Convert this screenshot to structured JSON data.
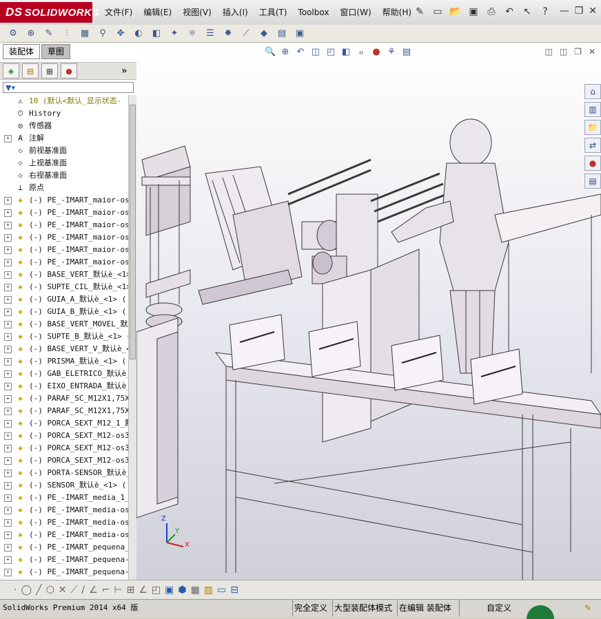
{
  "app": {
    "brand": "SOLIDWORKS",
    "brand_prefix": "DS"
  },
  "menu": [
    "文件(F)",
    "编辑(E)",
    "视图(V)",
    "插入(I)",
    "工具(T)",
    "Toolbox",
    "窗口(W)",
    "帮助(H)"
  ],
  "panel_tabs": [
    "装配体",
    "草图"
  ],
  "filter_icon": "filter-icon",
  "tree": [
    {
      "label": "10  (默认<默认_显示状态-",
      "icon": "assembly",
      "root": true,
      "expand": ""
    },
    {
      "label": "History",
      "icon": "history",
      "expand": ""
    },
    {
      "label": "传感器",
      "icon": "sensor",
      "expand": ""
    },
    {
      "label": "注解",
      "icon": "annotation",
      "expand": "+"
    },
    {
      "label": "前视基准面",
      "icon": "plane",
      "expand": ""
    },
    {
      "label": "上视基准面",
      "icon": "plane",
      "expand": ""
    },
    {
      "label": "右视基准面",
      "icon": "plane",
      "expand": ""
    },
    {
      "label": "原点",
      "icon": "origin",
      "expand": ""
    },
    {
      "label": "(-) PE_-IMART_maior-os2",
      "icon": "part",
      "expand": "+"
    },
    {
      "label": "(-) PE_-IMART_maior-os2",
      "icon": "part",
      "expand": "+"
    },
    {
      "label": "(-) PE_-IMART_maior-os2",
      "icon": "part",
      "expand": "+"
    },
    {
      "label": "(-) PE_-IMART_maior-os2",
      "icon": "part",
      "expand": "+"
    },
    {
      "label": "(-) PE_-IMART_maior-os2",
      "icon": "part",
      "expand": "+"
    },
    {
      "label": "(-) PE_-IMART_maior-os2",
      "icon": "part",
      "expand": "+"
    },
    {
      "label": "(-) BASE_VERT_默认è_<1>",
      "icon": "part",
      "expand": "+"
    },
    {
      "label": "(-) SUPTE_CIL_默认è_<1>",
      "icon": "part",
      "expand": "+"
    },
    {
      "label": "(-) GUIA_A_默认è_<1> (",
      "icon": "part",
      "expand": "+"
    },
    {
      "label": "(-) GUIA_B_默认è_<1> (",
      "icon": "part",
      "expand": "+"
    },
    {
      "label": "(-) BASE_VERT_MOVEL_默认",
      "icon": "part",
      "expand": "+"
    },
    {
      "label": "(-) SUPTE_B_默认è_<1> (",
      "icon": "part",
      "expand": "+"
    },
    {
      "label": "(-) BASE_VERT_V_默认è_<",
      "icon": "part",
      "expand": "+"
    },
    {
      "label": "(-) PRISMA_默认è_<1> (",
      "icon": "part",
      "expand": "+"
    },
    {
      "label": "(-) GAB_ELETRICO_默认è_",
      "icon": "part",
      "expand": "+"
    },
    {
      "label": "(-) EIXO_ENTRADA_默认è_",
      "icon": "part",
      "expand": "+"
    },
    {
      "label": "(-) PARAF_SC_M12X1,75X6",
      "icon": "part",
      "expand": "+"
    },
    {
      "label": "(-) PARAF_SC_M12X1,75X6",
      "icon": "part",
      "expand": "+"
    },
    {
      "label": "(-) PORCA_SEXT_M12_1_默",
      "icon": "part",
      "expand": "+"
    },
    {
      "label": "(-) PORCA_SEXT_M12-os31",
      "icon": "part",
      "expand": "+"
    },
    {
      "label": "(-) PORCA_SEXT_M12-os32",
      "icon": "part",
      "expand": "+"
    },
    {
      "label": "(-) PORCA_SEXT_M12-os33",
      "icon": "part",
      "expand": "+"
    },
    {
      "label": "(-) PORTA-SENSOR_默认è_",
      "icon": "part",
      "expand": "+"
    },
    {
      "label": "(-) SENSOR_默认è_<1> (",
      "icon": "part",
      "expand": "+"
    },
    {
      "label": "(-) PE_-IMART_media_1_默",
      "icon": "part",
      "expand": "+"
    },
    {
      "label": "(-) PE_-IMART_media-os3",
      "icon": "part",
      "expand": "+"
    },
    {
      "label": "(-) PE_-IMART_media-os3",
      "icon": "part",
      "expand": "+"
    },
    {
      "label": "(-) PE_-IMART_media-os3",
      "icon": "part",
      "expand": "+"
    },
    {
      "label": "(-) PE_-IMART_pequena_1",
      "icon": "part",
      "expand": "+"
    },
    {
      "label": "(-) PE_-IMART_pequena-o",
      "icon": "part",
      "expand": "+"
    },
    {
      "label": "(-) PE_-IMART_pequena-o",
      "icon": "part",
      "expand": "+"
    }
  ],
  "status": {
    "version": "SolidWorks Premium 2014 x64 版",
    "definition": "完全定义",
    "mode": "大型装配体模式",
    "editing": "在编辑 装配体",
    "units": "自定义"
  },
  "triad": {
    "z": "Z",
    "y": "Y",
    "x": "X"
  },
  "colors": {
    "brand": "#b8001f",
    "model": "#e6dfe6",
    "edge": "#3a3a3a"
  }
}
